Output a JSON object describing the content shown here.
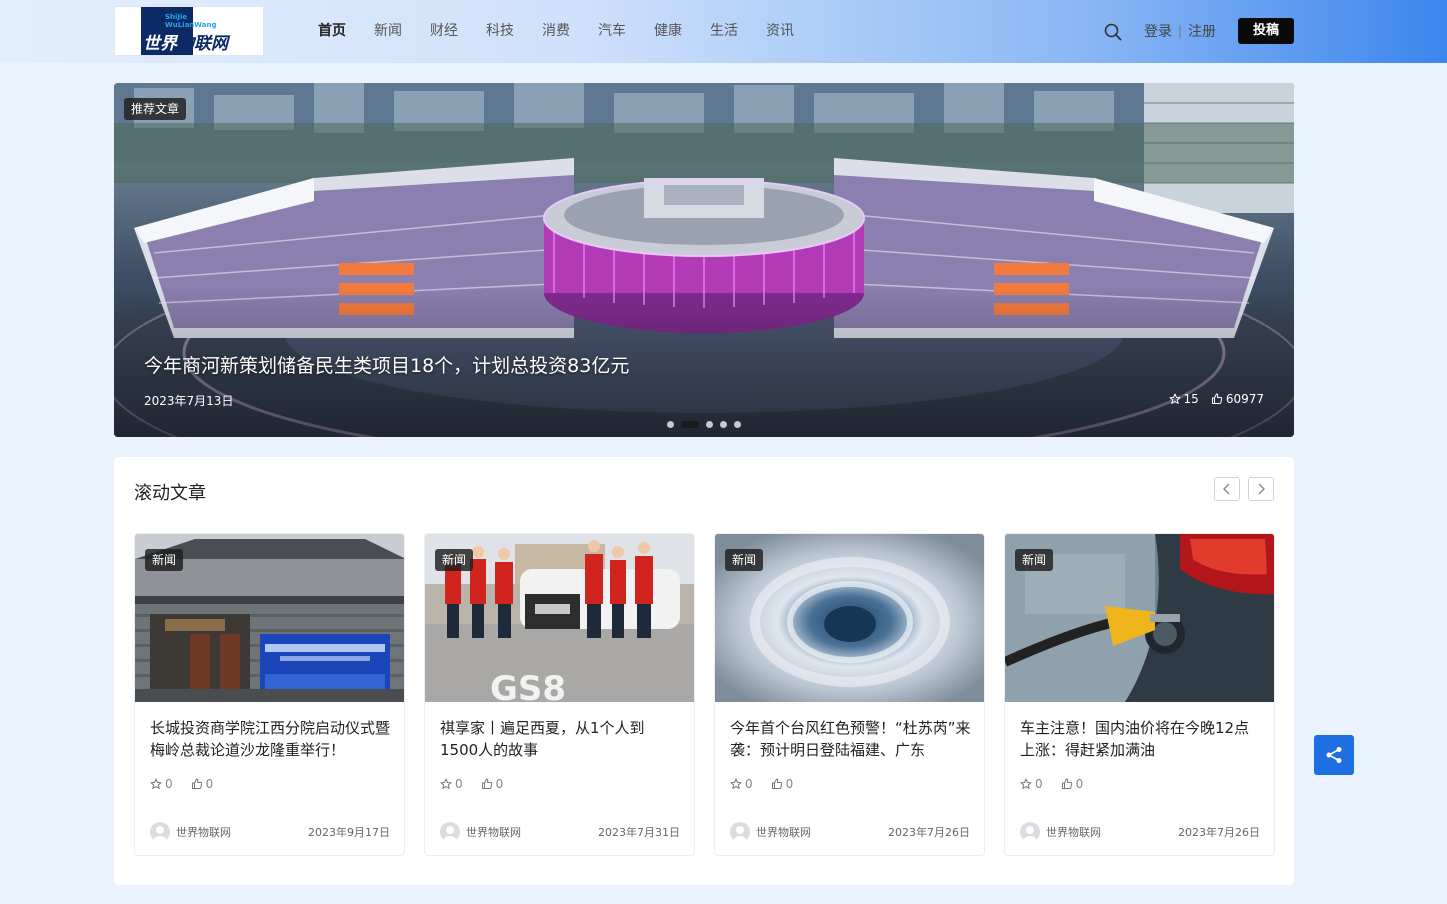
{
  "site": {
    "logo_small_1": "ShiJie",
    "logo_small_2": "WuLianWang",
    "logo_main_first": "世界",
    "logo_main_rest": "物联网"
  },
  "nav": {
    "items": [
      "首页",
      "新闻",
      "财经",
      "科技",
      "消费",
      "汽车",
      "健康",
      "生活",
      "资讯"
    ],
    "active": "首页"
  },
  "header": {
    "login": "登录",
    "separator": "|",
    "register": "注册",
    "submit": "投稿"
  },
  "banner": {
    "tag": "推荐文章",
    "title": "今年商河新策划储备民生类项目18个，计划总投资83亿元",
    "date": "2023年7月13日",
    "stars": "15",
    "likes": "60977",
    "slide_count": 5,
    "active_slide": 1
  },
  "scroll_section": {
    "title": "滚动文章",
    "articles": [
      {
        "tag": "新闻",
        "title": "长城投资商学院江西分院启动仪式暨梅岭总裁论道沙龙隆重举行！",
        "stars": "0",
        "likes": "0",
        "author": "世界物联网",
        "date": "2023年9月17日"
      },
      {
        "tag": "新闻",
        "title": "祺享家丨遍足西夏，从1个人到1500人的故事",
        "stars": "0",
        "likes": "0",
        "author": "世界物联网",
        "date": "2023年7月31日"
      },
      {
        "tag": "新闻",
        "title": "今年首个台风红色预警！“杜苏芮”来袭：预计明日登陆福建、广东",
        "stars": "0",
        "likes": "0",
        "author": "世界物联网",
        "date": "2023年7月26日"
      },
      {
        "tag": "新闻",
        "title": "车主注意！国内油价将在今晚12点上涨：得赶紧加满油",
        "stars": "0",
        "likes": "0",
        "author": "世界物联网",
        "date": "2023年7月26日"
      }
    ]
  },
  "colors": {
    "accent": "#1e6fe2",
    "submit_bg": "#0a0a0a",
    "page_bg": "#eaf2fd"
  },
  "icons": {
    "search": "search-icon",
    "star": "star-icon",
    "like": "thumbs-up-icon",
    "share": "share-icon"
  }
}
